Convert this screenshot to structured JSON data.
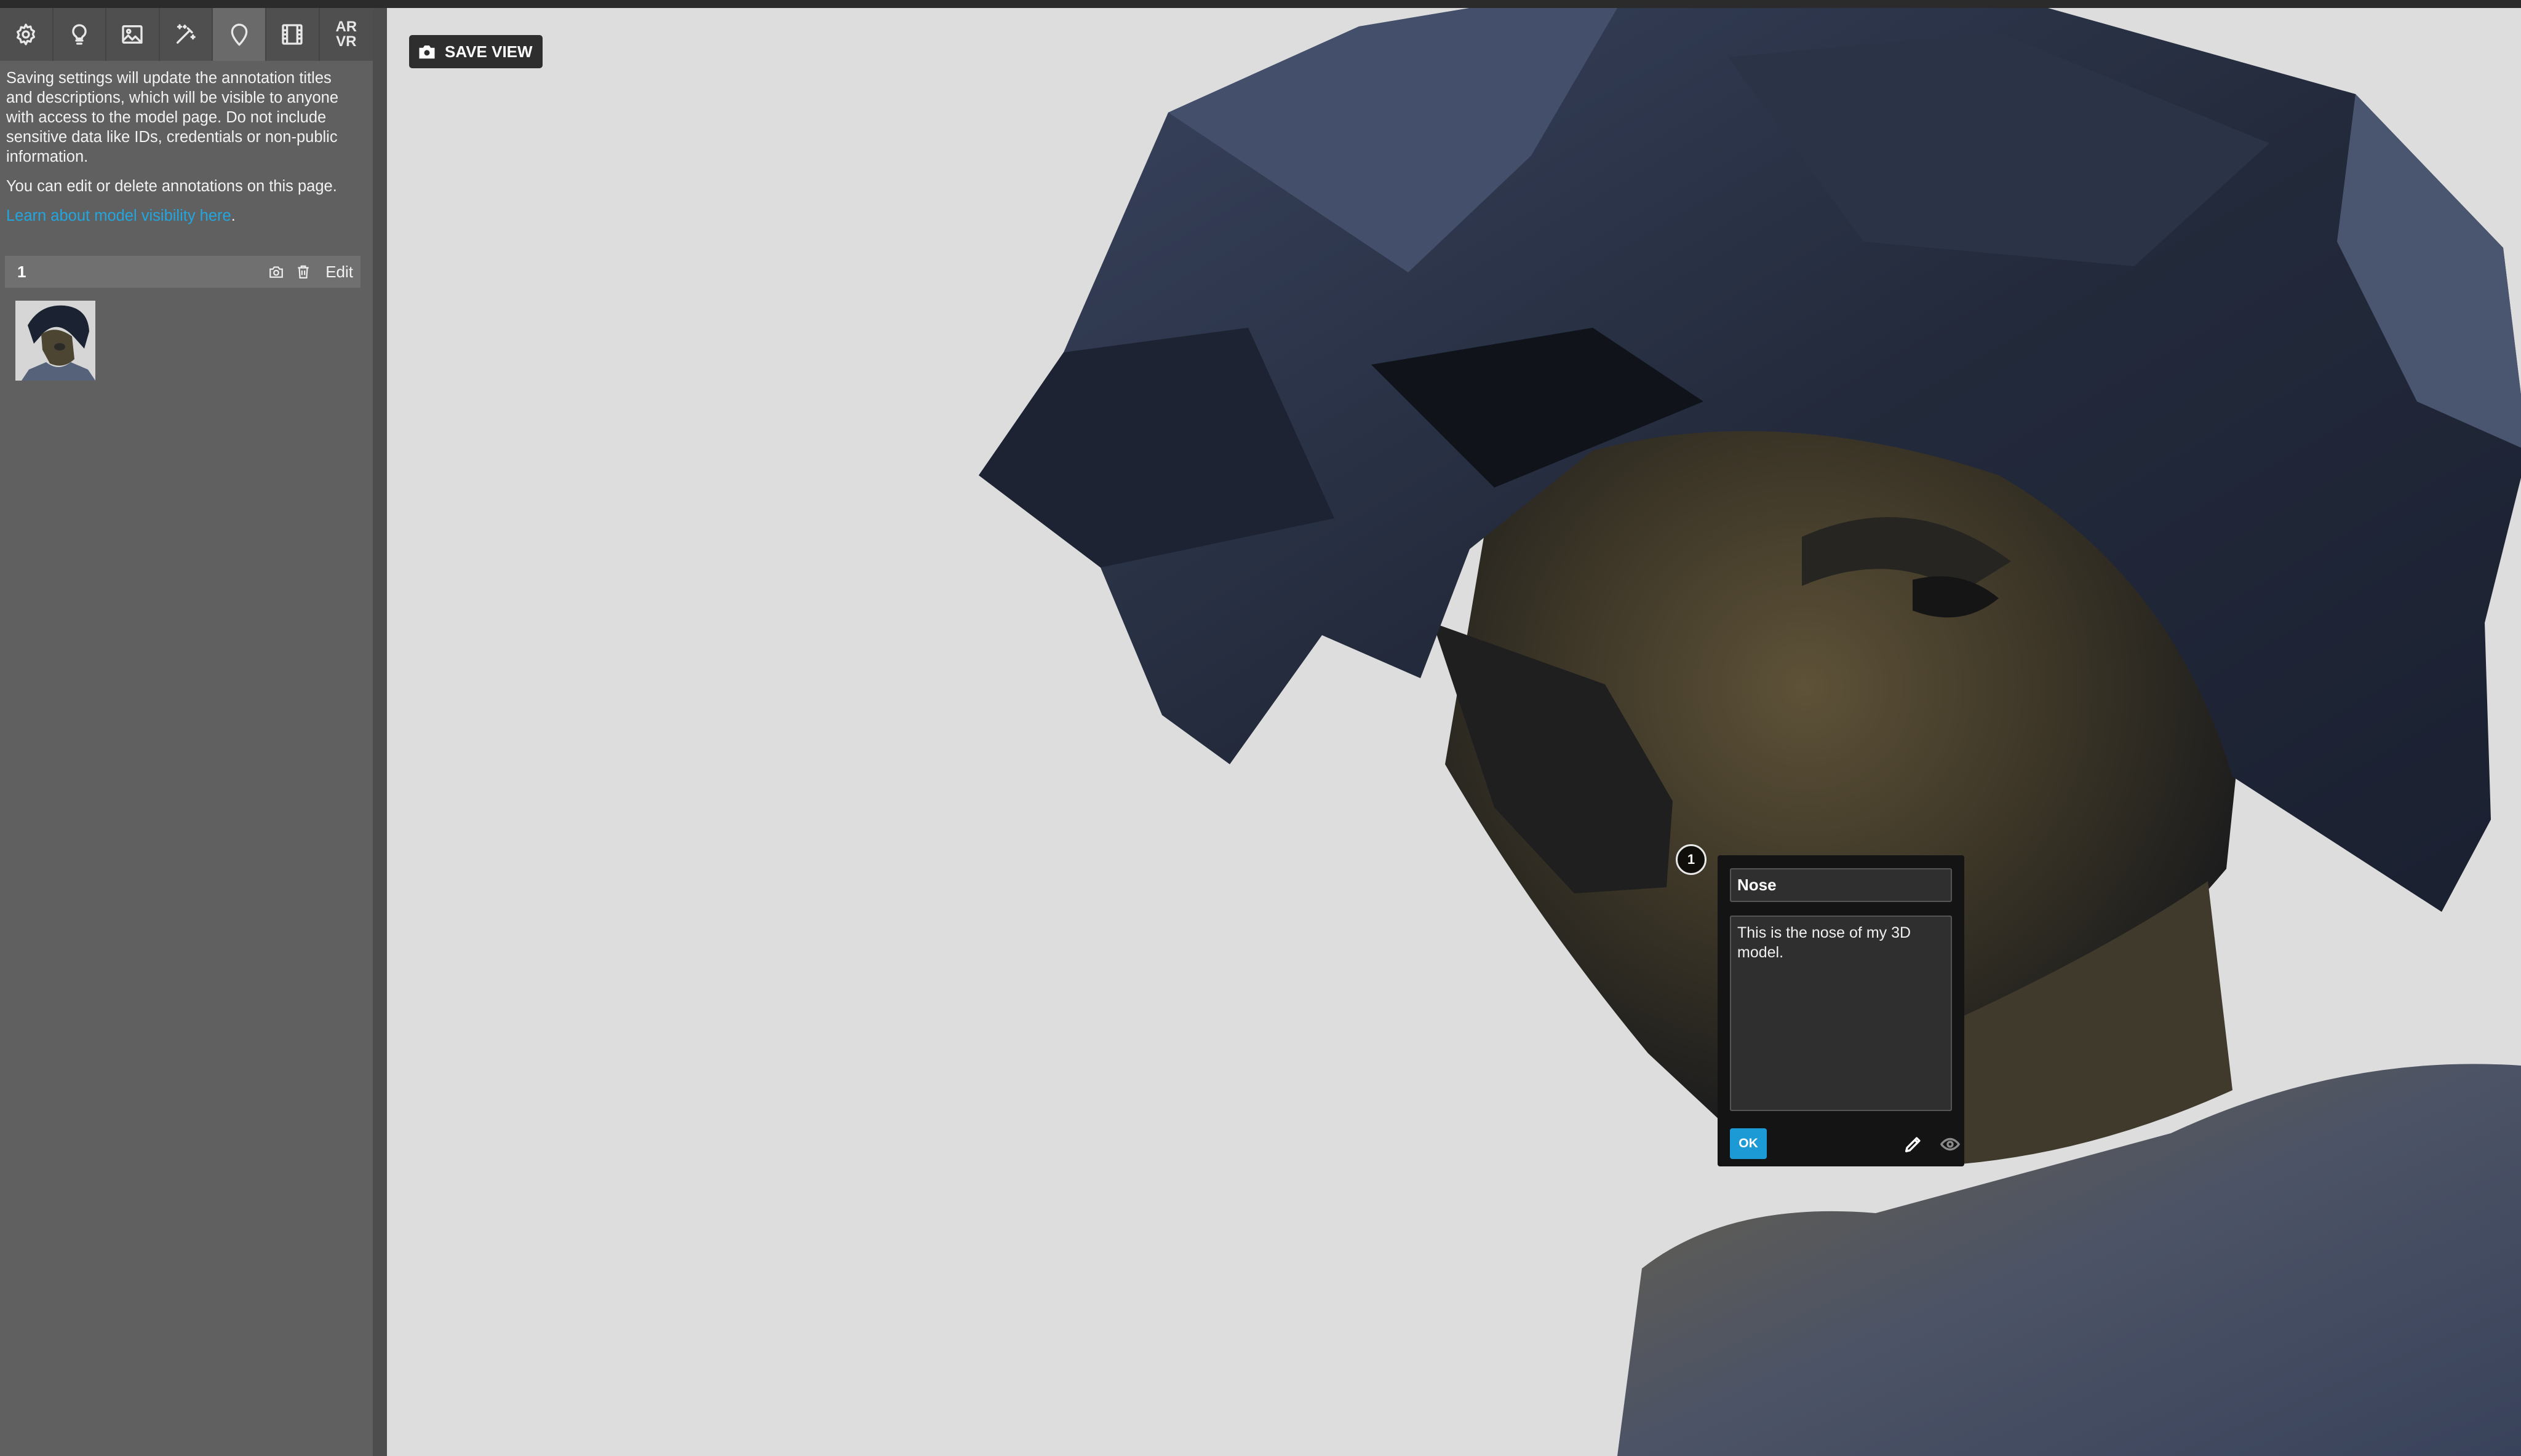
{
  "toolbar": {
    "tools": [
      {
        "name": "gear-icon",
        "label": "General"
      },
      {
        "name": "lightbulb-icon",
        "label": "Lighting"
      },
      {
        "name": "image-icon",
        "label": "Background"
      },
      {
        "name": "magic-wand-icon",
        "label": "Post-processing"
      },
      {
        "name": "map-pin-icon",
        "label": "Annotations",
        "active": true
      },
      {
        "name": "film-icon",
        "label": "Animation"
      }
    ],
    "arvr_line1": "AR",
    "arvr_line2": "VR"
  },
  "sidebar": {
    "notice": "Saving settings will update the annotation titles and descriptions, which will be visible to anyone with access to the model page. Do not include sensitive data like IDs, credentials or non-public information.",
    "edit_hint": "You can edit or delete annotations on this page.",
    "learn_link": "Learn about model visibility here",
    "learn_suffix": ".",
    "annotation": {
      "number": "1",
      "edit_label": "Edit"
    }
  },
  "viewport": {
    "save_view_label": "SAVE VIEW",
    "hotspot_number": "1",
    "popup": {
      "title_value": "Nose",
      "description_value": "This is the nose of my 3D model.",
      "ok_label": "OK"
    }
  },
  "colors": {
    "accent": "#1c9ad6",
    "link": "#22a6e0",
    "sidebar_bg": "#606060",
    "viewport_bg": "#dddddd"
  }
}
